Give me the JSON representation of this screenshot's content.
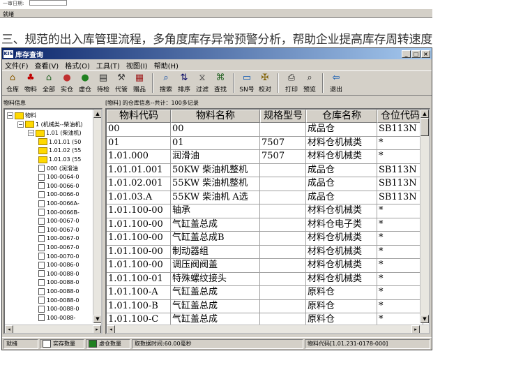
{
  "top_fragment": {
    "date_label": "一审日期:",
    "status_text": "就绪"
  },
  "heading": "三、规范的出入库管理流程，多角度库存异常预警分析，帮助企业提高库存周转速度",
  "window": {
    "app_badge": "KIS",
    "title": "库存查询",
    "controls": {
      "minimize": "_",
      "maximize": "□",
      "close": "×"
    },
    "menu": [
      "文件(F)",
      "查看(V)",
      "格式(O)",
      "工具(T)",
      "视图(I)",
      "帮助(H)"
    ],
    "toolbar_groups": [
      [
        {
          "label": "仓库",
          "icon": "warehouse-icon",
          "glyph": "⌂",
          "color": "#8a5a00"
        },
        {
          "label": "物料",
          "icon": "material-icon",
          "glyph": "♣",
          "color": "#c00000"
        },
        {
          "label": "全部",
          "icon": "all-icon",
          "glyph": "⌂",
          "color": "#206020"
        },
        {
          "label": "实仓",
          "icon": "real-warehouse-icon",
          "glyph": "●",
          "color": "#c03030"
        },
        {
          "label": "虚仓",
          "icon": "virtual-warehouse-icon",
          "glyph": "●",
          "color": "#208020"
        },
        {
          "label": "待检",
          "icon": "pending-inspect-icon",
          "glyph": "▤",
          "color": "#303030"
        },
        {
          "label": "代管",
          "icon": "custody-icon",
          "glyph": "⚒",
          "color": "#404040"
        },
        {
          "label": "赠品",
          "icon": "gift-icon",
          "glyph": "▦",
          "color": "#a02020"
        }
      ],
      [
        {
          "label": "搜索",
          "icon": "search-icon",
          "glyph": "⌕",
          "color": "#0040a0"
        },
        {
          "label": "排序",
          "icon": "sort-icon",
          "glyph": "⇅",
          "color": "#000060"
        },
        {
          "label": "过滤",
          "icon": "filter-icon",
          "glyph": "⧖",
          "color": "#404040"
        },
        {
          "label": "查找",
          "icon": "find-icon",
          "glyph": "⌘",
          "color": "#206020"
        }
      ],
      [
        {
          "label": "SN号",
          "icon": "serial-number-icon",
          "glyph": "▭",
          "color": "#0050b0"
        },
        {
          "label": "校对",
          "icon": "proofread-icon",
          "glyph": "✠",
          "color": "#806000"
        }
      ],
      [
        {
          "label": "打印",
          "icon": "print-icon",
          "glyph": "⎙",
          "color": "#303030"
        },
        {
          "label": "预览",
          "icon": "preview-icon",
          "glyph": "⌕",
          "color": "#303030"
        }
      ],
      [
        {
          "label": "退出",
          "icon": "exit-icon",
          "glyph": "⇦",
          "color": "#0050b0"
        }
      ]
    ],
    "left_panel_label": "物料信息",
    "grid_caption": "[物料] 的仓库信息--共计：100多记录",
    "tree": [
      {
        "level": 0,
        "kind": "folder",
        "expander": "⊟",
        "label": "物料"
      },
      {
        "level": 1,
        "kind": "folder",
        "expander": "⊟",
        "label": "1 (机械类--柴油机)"
      },
      {
        "level": 2,
        "kind": "folder",
        "expander": "⊟",
        "label": "1.01 (柴油机)"
      },
      {
        "level": 3,
        "kind": "folder",
        "expander": "",
        "label": "1.01.01 (50"
      },
      {
        "level": 3,
        "kind": "folder",
        "expander": "",
        "label": "1.01.02 (55"
      },
      {
        "level": 3,
        "kind": "folder",
        "expander": "",
        "label": "1.01.03 (55"
      },
      {
        "level": 3,
        "kind": "doc",
        "expander": "",
        "label": "000 (润滑油"
      },
      {
        "level": 3,
        "kind": "doc",
        "expander": "",
        "label": "100-0064-0"
      },
      {
        "level": 3,
        "kind": "doc",
        "expander": "",
        "label": "100-0066-0"
      },
      {
        "level": 3,
        "kind": "doc",
        "expander": "",
        "label": "100-0066-0"
      },
      {
        "level": 3,
        "kind": "doc",
        "expander": "",
        "label": "100-0066A-"
      },
      {
        "level": 3,
        "kind": "doc",
        "expander": "",
        "label": "100-0066B-"
      },
      {
        "level": 3,
        "kind": "doc",
        "expander": "",
        "label": "100-0067-0"
      },
      {
        "level": 3,
        "kind": "doc",
        "expander": "",
        "label": "100-0067-0"
      },
      {
        "level": 3,
        "kind": "doc",
        "expander": "",
        "label": "100-0067-0"
      },
      {
        "level": 3,
        "kind": "doc",
        "expander": "",
        "label": "100-0067-0"
      },
      {
        "level": 3,
        "kind": "doc",
        "expander": "",
        "label": "100-0070-0"
      },
      {
        "level": 3,
        "kind": "doc",
        "expander": "",
        "label": "100-0086-0"
      },
      {
        "level": 3,
        "kind": "doc",
        "expander": "",
        "label": "100-0088-0"
      },
      {
        "level": 3,
        "kind": "doc",
        "expander": "",
        "label": "100-0088-0"
      },
      {
        "level": 3,
        "kind": "doc",
        "expander": "",
        "label": "100-0088-0"
      },
      {
        "level": 3,
        "kind": "doc",
        "expander": "",
        "label": "100-0088-0"
      },
      {
        "level": 3,
        "kind": "doc",
        "expander": "",
        "label": "100-0088-0"
      },
      {
        "level": 3,
        "kind": "doc",
        "expander": "",
        "label": "100-0088-"
      }
    ],
    "columns": [
      "物料代码",
      "物料名称",
      "规格型号",
      "仓库名称",
      "仓位代码"
    ],
    "rows": [
      [
        "00",
        "00",
        "",
        "成品仓",
        "SB113N"
      ],
      [
        "01",
        "01",
        "7507",
        "材料仓机械类",
        "*"
      ],
      [
        "1.01.000",
        "润滑油",
        "7507",
        "材料仓机械类",
        "*"
      ],
      [
        "1.01.01.001",
        "50KW 柴油机整机",
        "",
        "成品仓",
        "SB113N"
      ],
      [
        "1.01.02.001",
        "55KW 柴油机整机",
        "",
        "成品仓",
        "SB113N"
      ],
      [
        "1.01.03.A",
        "55KW 柴油机  A选",
        "",
        "成品仓",
        "SB113N"
      ],
      [
        "1.01.100-00",
        "轴承",
        "",
        "材料仓机械类",
        "*"
      ],
      [
        "1.01.100-00",
        "气缸盖总成",
        "",
        "材料仓电子类",
        "*"
      ],
      [
        "1.01.100-00",
        "气缸盖总成B",
        "",
        "材料仓机械类",
        "*"
      ],
      [
        "1.01.100-00",
        "制动器组",
        "",
        "材料仓机械类",
        "*"
      ],
      [
        "1.01.100-00",
        "调压阀阀盖",
        "",
        "材料仓机械类",
        "*"
      ],
      [
        "1.01.100-01",
        "特殊螺纹接头",
        "",
        "材料仓机械类",
        "*"
      ],
      [
        "1.01.100-A",
        "气缸盖总成",
        "",
        "原料仓",
        "*"
      ],
      [
        "1.01.100-B",
        "气缸盖总成",
        "",
        "原料仓",
        "*"
      ],
      [
        "1.01.100-C",
        "气缸盖总成",
        "",
        "原料仓",
        "*"
      ]
    ],
    "status": {
      "ready": "就绪",
      "legend_real": "实存数量",
      "legend_real_color": "#ffffff",
      "legend_virtual": "虚仓数量",
      "legend_virtual_color": "#208020",
      "elapsed": "取数据时间:60.00毫秒",
      "current_code": "物料代码[1.01.231-0178-000]"
    }
  }
}
